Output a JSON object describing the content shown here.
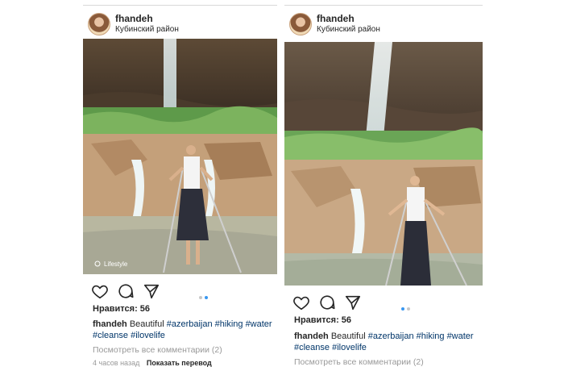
{
  "posts": [
    {
      "username": "fhandeh",
      "location": "Кубинский район",
      "likes": "Нравится: 56",
      "caption_user": "fhandeh",
      "caption_text": "Beautiful",
      "tags_line1": "#azerbaijan #hiking #water",
      "tags_line2": "#cleanse #ilovelife",
      "comments": "Посмотреть все комментарии (2)",
      "time": "4 часов назад",
      "translate": "Показать перевод",
      "watermark": "Lifestyle",
      "icons": [
        "heart-icon",
        "comment-icon",
        "share-icon"
      ]
    },
    {
      "username": "fhandeh",
      "location": "Кубинский район",
      "likes": "Нравится: 56",
      "caption_user": "fhandeh",
      "caption_text": "Beautiful",
      "tags_line1": "#azerbaijan #hiking #water",
      "tags_line2": "#cleanse #ilovelife",
      "comments": "Посмотреть все комментарии (2)",
      "icons": [
        "heart-icon",
        "comment-icon",
        "share-icon"
      ]
    }
  ],
  "colors": {
    "accent_dot": "#3897f0",
    "hashtag": "#003569",
    "muted": "#999999",
    "text": "#262626"
  }
}
